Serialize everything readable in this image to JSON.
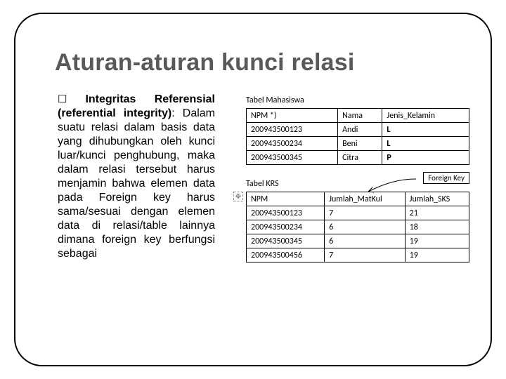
{
  "heading": "Aturan-aturan kunci relasi",
  "body": {
    "lead_bold": "Integritas Referensial (referential integrity)",
    "rest": ": Dalam suatu relasi dalam basis data yang dihubungkan oleh kunci luar/kunci penghubung, maka dalam relasi tersebut harus menjamin bahwa elemen data pada Foreign key harus sama/sesuai dengan elemen data di relasi/table lainnya dimana foreign key berfungsi sebagai"
  },
  "table1": {
    "title": "Tabel Mahasiswa",
    "headers": [
      "NPM *)",
      "Nama",
      "Jenis_Kelamin"
    ],
    "rows": [
      [
        "200943500123",
        "Andi",
        "L"
      ],
      [
        "200943500234",
        "Beni",
        "L"
      ],
      [
        "200943500345",
        "Citra",
        "P"
      ]
    ]
  },
  "fk_label": "Foreign Key",
  "table2": {
    "title": "Tabel KRS",
    "headers": [
      "NPM",
      "Jumlah_MatKul",
      "Jumlah_SKS"
    ],
    "rows": [
      [
        "200943500123",
        "7",
        "21"
      ],
      [
        "200943500234",
        "6",
        "18"
      ],
      [
        "200943500345",
        "6",
        "19"
      ],
      [
        "200943500456",
        "7",
        "19"
      ]
    ]
  },
  "anchor_glyph": "✥"
}
